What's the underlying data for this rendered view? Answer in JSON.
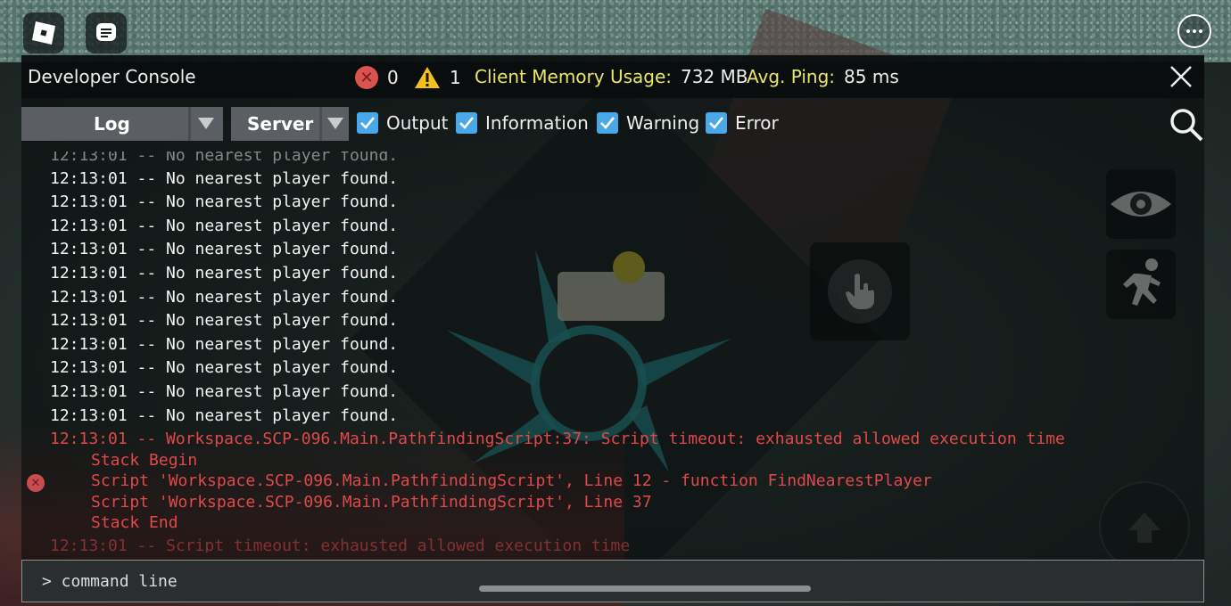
{
  "console": {
    "title": "Developer Console",
    "error_count": "0",
    "warning_count": "1",
    "memory_label": "Client Memory Usage:",
    "memory_value": "732 MB",
    "ping_label": "Avg. Ping:",
    "ping_value": "85 ms",
    "log_dropdown": "Log",
    "server_dropdown": "Server",
    "filters": {
      "output": "Output",
      "information": "Information",
      "warning": "Warning",
      "error": "Error"
    },
    "command_placeholder": "> command line"
  },
  "log_lines": {
    "partial_top": "12:13:01 -- No nearest player found.",
    "line_0": "12:13:01 -- No nearest player found.",
    "line_1": "12:13:01 -- No nearest player found.",
    "line_2": "12:13:01 -- No nearest player found.",
    "line_3": "12:13:01 -- No nearest player found.",
    "line_4": "12:13:01 -- No nearest player found.",
    "line_5": "12:13:01 -- No nearest player found.",
    "line_6": "12:13:01 -- No nearest player found.",
    "line_7": "12:13:01 -- No nearest player found.",
    "line_8": "12:13:01 -- No nearest player found.",
    "line_9": "12:13:01 -- No nearest player found.",
    "line_10": "12:13:01 -- No nearest player found.",
    "err_main": "12:13:01 -- Workspace.SCP-096.Main.PathfindingScript:37: Script timeout: exhausted allowed execution time",
    "stack_begin": "Stack Begin",
    "stack_1": "Script 'Workspace.SCP-096.Main.PathfindingScript', Line 12 - function FindNearestPlayer",
    "stack_2": "Script 'Workspace.SCP-096.Main.PathfindingScript', Line 37",
    "stack_end": "Stack End",
    "err_last": "12:13:01 -- Script timeout: exhausted allowed execution time"
  },
  "icons": {
    "roblox": "roblox-logo-icon",
    "chat": "chat-icon",
    "more": "more-icon",
    "close": "close-icon",
    "search": "search-icon",
    "eye": "eye-icon",
    "run": "run-icon",
    "tap": "hand-tap-icon",
    "jump": "jump-arrow-icon"
  },
  "colors": {
    "error": "#e0494a",
    "memory_label": "#e8e66a",
    "checkbox": "#4aa8e8"
  }
}
